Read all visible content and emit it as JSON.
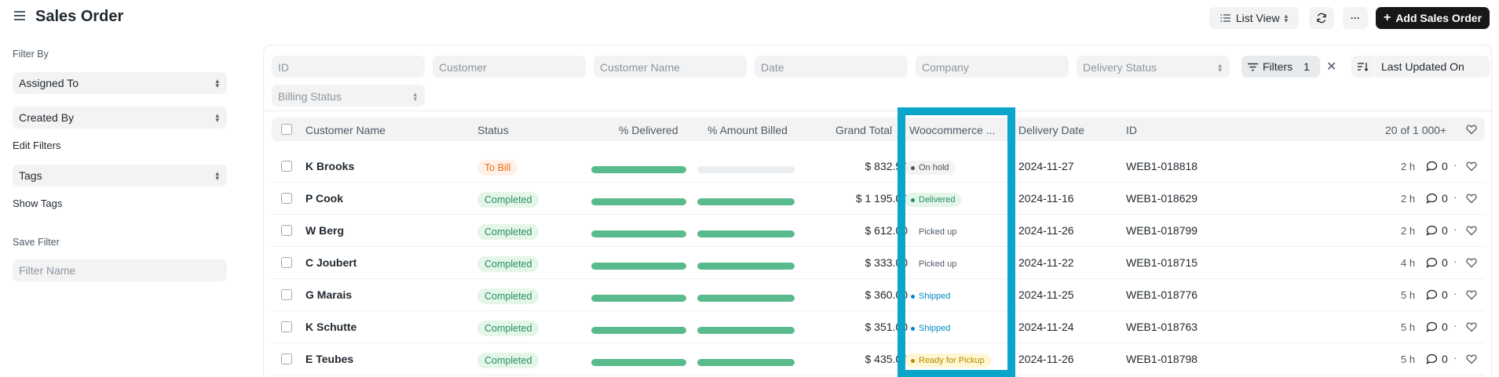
{
  "header": {
    "title": "Sales Order",
    "list_view_label": "List View",
    "more_label": "···",
    "add_label": "Add Sales Order"
  },
  "sidebar": {
    "filter_by_label": "Filter By",
    "assigned_to": "Assigned To",
    "created_by": "Created By",
    "edit_filters": "Edit Filters",
    "tags": "Tags",
    "show_tags": "Show Tags",
    "save_filter_label": "Save Filter",
    "filter_name_placeholder": "Filter Name"
  },
  "filters": {
    "id": "ID",
    "customer": "Customer",
    "customer_name": "Customer Name",
    "date": "Date",
    "company": "Company",
    "delivery_status": "Delivery Status",
    "billing_status": "Billing Status",
    "filters_label": "Filters",
    "filters_count": "1",
    "sort_label": "Last Updated On"
  },
  "columns": {
    "customer_name": "Customer Name",
    "status": "Status",
    "pct_delivered": "% Delivered",
    "pct_billed": "% Amount Billed",
    "grand_total": "Grand Total",
    "woocommerce": "Woocommerce ...",
    "delivery_date": "Delivery Date",
    "id": "ID",
    "count": "20 of 1 000+"
  },
  "rows": [
    {
      "customer": "K Brooks",
      "status": "To Bill",
      "status_type": "tobill",
      "delivered": 1.0,
      "billed": 0.0,
      "total": "$ 832.50",
      "woo": "On hold",
      "woo_color": "#525252",
      "woo_bg": "#f3f3f3",
      "woo_dot": true,
      "date": "2024-11-27",
      "id": "WEB1-018818",
      "age": "2 h",
      "comments": "0"
    },
    {
      "customer": "P Cook",
      "status": "Completed",
      "status_type": "completed",
      "delivered": 1.0,
      "billed": 1.0,
      "total": "$ 1 195.00",
      "woo": "Delivered",
      "woo_color": "#278f5e",
      "woo_bg": "#e4f5e9",
      "woo_dot": true,
      "date": "2024-11-16",
      "id": "WEB1-018629",
      "age": "2 h",
      "comments": "0"
    },
    {
      "customer": "W Berg",
      "status": "Completed",
      "status_type": "completed",
      "delivered": 1.0,
      "billed": 1.0,
      "total": "$ 612.00",
      "woo": "Picked up",
      "woo_color": "#4c5a67",
      "woo_bg": "transparent",
      "woo_dot": false,
      "date": "2024-11-26",
      "id": "WEB1-018799",
      "age": "2 h",
      "comments": "0"
    },
    {
      "customer": "C Joubert",
      "status": "Completed",
      "status_type": "completed",
      "delivered": 1.0,
      "billed": 1.0,
      "total": "$ 333.00",
      "woo": "Picked up",
      "woo_color": "#4c5a67",
      "woo_bg": "transparent",
      "woo_dot": false,
      "date": "2024-11-22",
      "id": "WEB1-018715",
      "age": "4 h",
      "comments": "0"
    },
    {
      "customer": "G Marais",
      "status": "Completed",
      "status_type": "completed",
      "delivered": 1.0,
      "billed": 1.0,
      "total": "$ 360.00",
      "woo": "Shipped",
      "woo_color": "#0289c2",
      "woo_bg": "transparent",
      "woo_dot": true,
      "date": "2024-11-25",
      "id": "WEB1-018776",
      "age": "5 h",
      "comments": "0"
    },
    {
      "customer": "K Schutte",
      "status": "Completed",
      "status_type": "completed",
      "delivered": 1.0,
      "billed": 1.0,
      "total": "$ 351.00",
      "woo": "Shipped",
      "woo_color": "#0289c2",
      "woo_bg": "transparent",
      "woo_dot": true,
      "date": "2024-11-24",
      "id": "WEB1-018763",
      "age": "5 h",
      "comments": "0"
    },
    {
      "customer": "E Teubes",
      "status": "Completed",
      "status_type": "completed",
      "delivered": 1.0,
      "billed": 1.0,
      "total": "$ 435.00",
      "woo": "Ready for Pickup",
      "woo_color": "#b88a00",
      "woo_bg": "#fff7d3",
      "woo_dot": true,
      "date": "2024-11-26",
      "id": "WEB1-018798",
      "age": "5 h",
      "comments": "0"
    }
  ],
  "colors": {
    "primary": "#171717",
    "highlight": "#0aa5c9",
    "progress": "#59ba8b"
  }
}
